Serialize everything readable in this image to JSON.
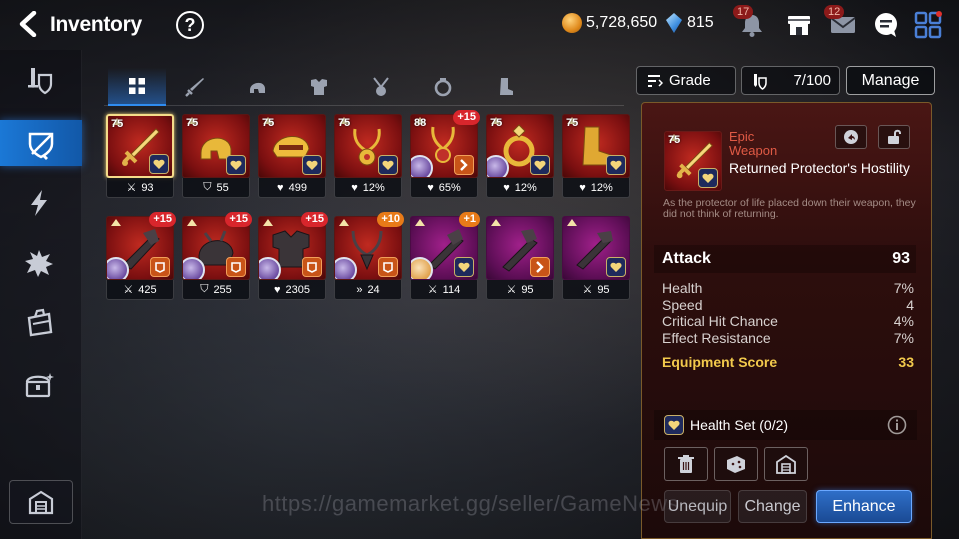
{
  "header": {
    "title": "Inventory",
    "help": "?",
    "gold": "5,728,650",
    "crystals": "815",
    "notif_badge": "17",
    "mail_badge": "12"
  },
  "tabs": [
    "all",
    "weapon",
    "helmet",
    "armor",
    "necklace",
    "ring",
    "boots"
  ],
  "items_row1": [
    {
      "lvl": "75",
      "stat_icon": "weapon",
      "stat": "93",
      "plus": "",
      "selected": true
    },
    {
      "lvl": "75",
      "stat_icon": "shield",
      "stat": "55",
      "plus": ""
    },
    {
      "lvl": "75",
      "stat_icon": "heart",
      "stat": "499",
      "plus": ""
    },
    {
      "lvl": "75",
      "stat_icon": "heart",
      "stat": "12%",
      "plus": ""
    },
    {
      "lvl": "88",
      "stat_icon": "heart",
      "stat": "65%",
      "plus": "+15"
    },
    {
      "lvl": "75",
      "stat_icon": "heart",
      "stat": "12%",
      "plus": ""
    },
    {
      "lvl": "75",
      "stat_icon": "heart",
      "stat": "12%",
      "plus": ""
    }
  ],
  "items_row2": [
    {
      "stat": "425",
      "plus": "+15"
    },
    {
      "stat": "255",
      "plus": "+15"
    },
    {
      "stat": "2305",
      "plus": "+15"
    },
    {
      "stat": "24",
      "plus": "+10"
    },
    {
      "stat": "114",
      "plus": "+1"
    },
    {
      "stat": "95",
      "plus": ""
    },
    {
      "stat": "95",
      "plus": ""
    }
  ],
  "controls": {
    "grade": "Grade",
    "capacity": "7/100",
    "manage": "Manage"
  },
  "detail": {
    "level": "75",
    "rarity": "Epic Weapon",
    "name": "Returned Protector's Hostility",
    "description": "As the protector of life placed down their weapon, they did not think of returning.",
    "main_stat": {
      "label": "Attack",
      "value": "93"
    },
    "sub_stats": [
      {
        "label": "Health",
        "value": "7%"
      },
      {
        "label": "Speed",
        "value": "4"
      },
      {
        "label": "Critical Hit Chance",
        "value": "4%"
      },
      {
        "label": "Effect Resistance",
        "value": "7%"
      }
    ],
    "score": {
      "label": "Equipment Score",
      "value": "33"
    },
    "set": "Health Set (0/2)",
    "buttons": {
      "unequip": "Unequip",
      "change": "Change",
      "enhance": "Enhance"
    }
  },
  "watermark": "https://gamemarket.gg/seller/GameNews",
  "colors": {
    "accent": "#1b78d6",
    "epic": "#e05a45",
    "score": "#f2c94c"
  }
}
